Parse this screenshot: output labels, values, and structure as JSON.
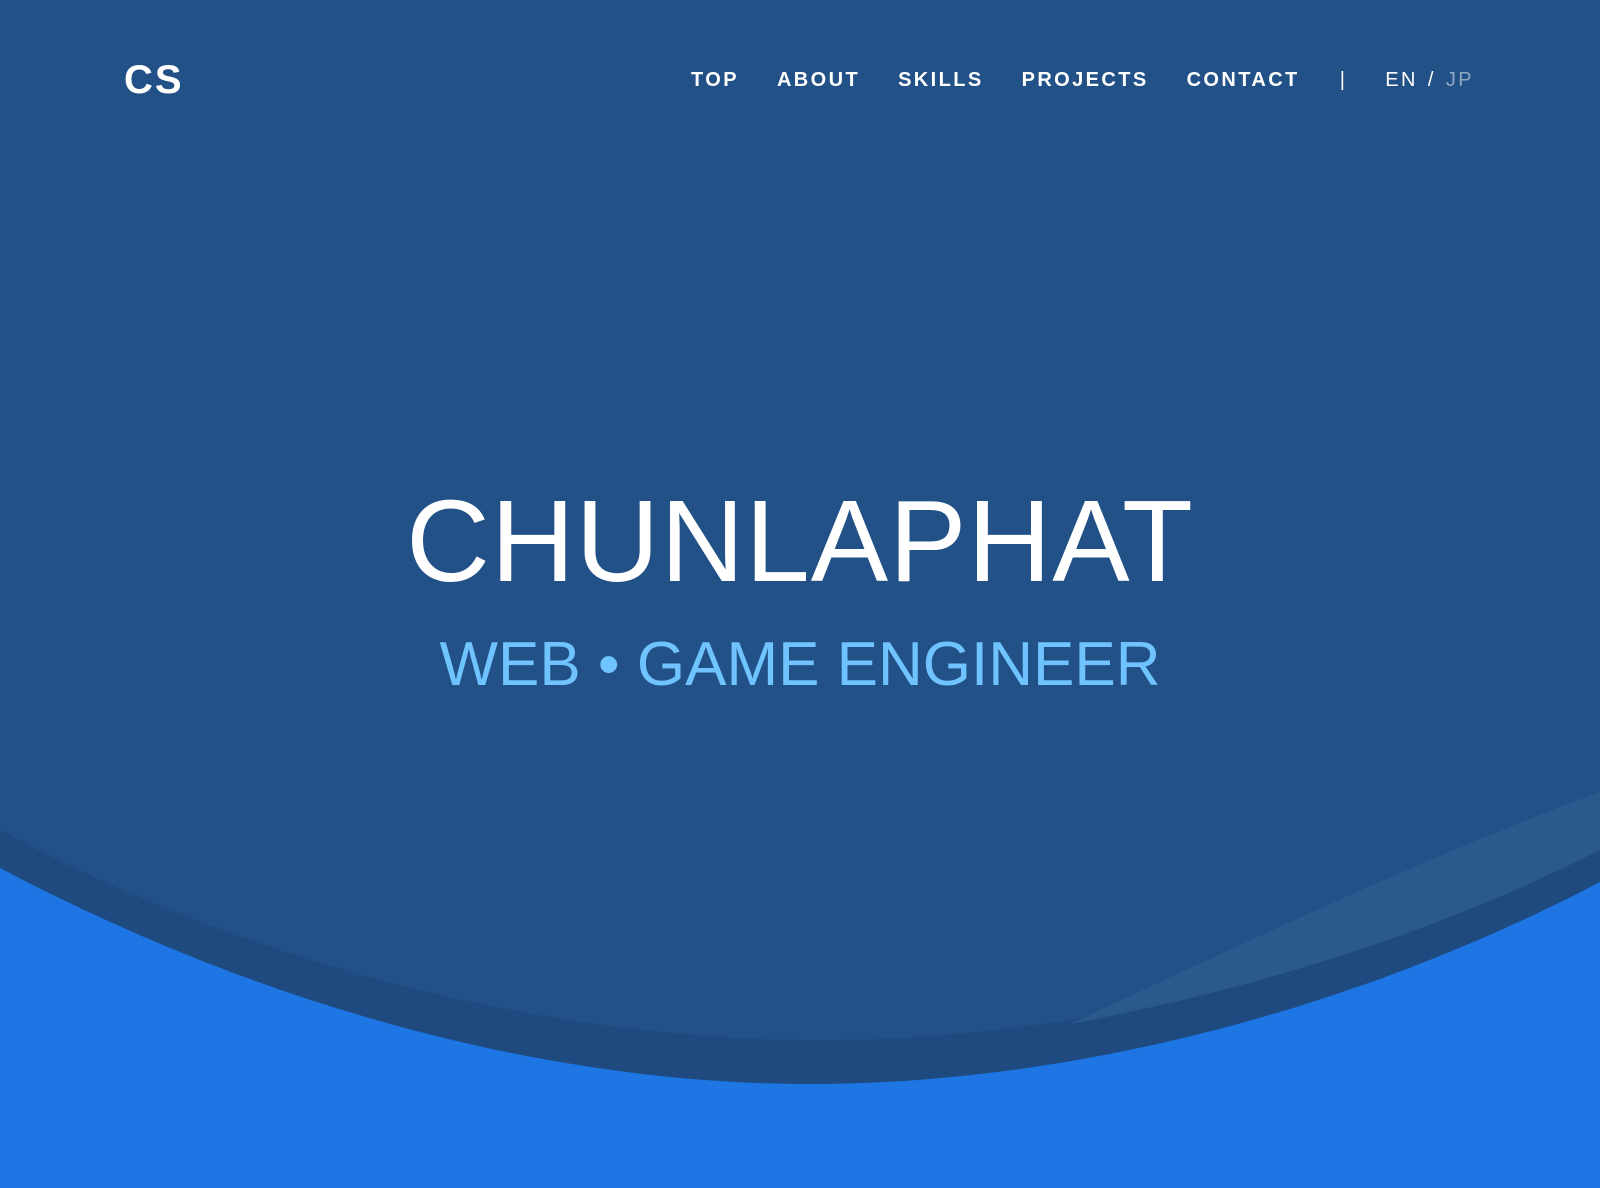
{
  "header": {
    "logo": "CS"
  },
  "nav": {
    "items": [
      {
        "label": "TOP"
      },
      {
        "label": "ABOUT"
      },
      {
        "label": "SKILLS"
      },
      {
        "label": "PROJECTS"
      },
      {
        "label": "CONTACT"
      }
    ],
    "divider": "|",
    "language": {
      "en": "EN",
      "separator": "/",
      "jp": "JP"
    }
  },
  "hero": {
    "name": "CHUNLAPHAT",
    "title": "WEB • GAME ENGINEER"
  },
  "colors": {
    "background": "#225187",
    "wave_dark": "#1e4a80",
    "wave_highlight": "#2a5a8e",
    "wave_bright": "#1d76e3",
    "subtitle": "#6fc3ff",
    "inactive_language": "#8fa7c3"
  }
}
